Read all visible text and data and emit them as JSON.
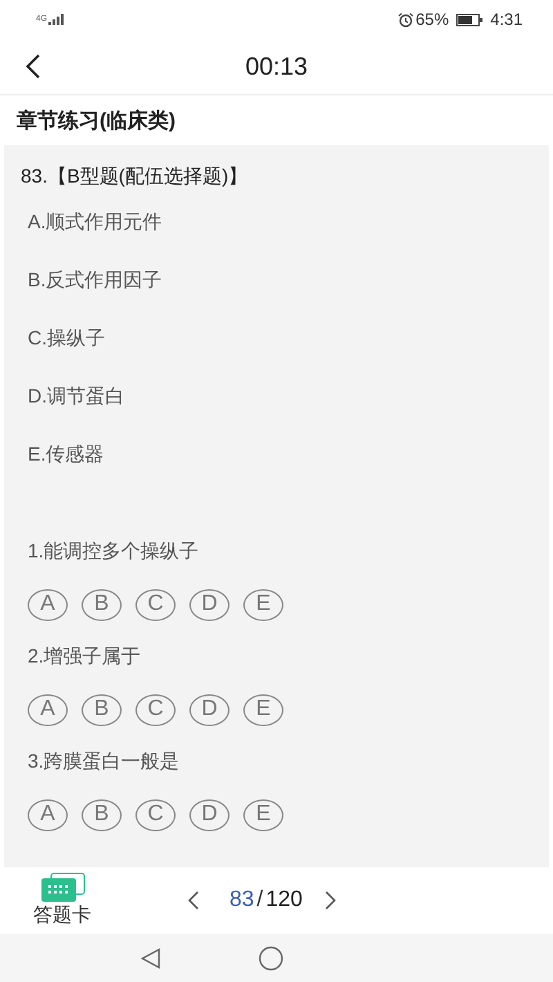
{
  "status_bar": {
    "network": "4G",
    "battery": "65%",
    "time": "4:31"
  },
  "header": {
    "timer": "00:13"
  },
  "section_title": "章节练习(临床类)",
  "question": {
    "title": "83.【B型题(配伍选择题)】",
    "options": [
      "A.顺式作用元件",
      "B.反式作用因子",
      "C.操纵子",
      "D.调节蛋白",
      "E.传感器"
    ]
  },
  "sub_questions": [
    {
      "text": "1.能调控多个操纵子",
      "choices": [
        {
          "label": "A",
          "selected": false
        },
        {
          "label": "B",
          "selected": false
        },
        {
          "label": "C",
          "selected": false
        },
        {
          "label": "D",
          "selected": false
        },
        {
          "label": "E",
          "selected": false
        }
      ]
    },
    {
      "text": "2.增强子属于",
      "choices": [
        {
          "label": "A",
          "selected": false
        },
        {
          "label": "B",
          "selected": false
        },
        {
          "label": "C",
          "selected": false
        },
        {
          "label": "D",
          "selected": false
        },
        {
          "label": "E",
          "selected": false
        }
      ]
    },
    {
      "text": "3.跨膜蛋白一般是",
      "choices": [
        {
          "label": "A",
          "selected": false
        },
        {
          "label": "B",
          "selected": false
        },
        {
          "label": "C",
          "selected": false
        },
        {
          "label": "D",
          "selected": false
        },
        {
          "label": "E",
          "selected": false
        }
      ]
    }
  ],
  "bottom_bar": {
    "answer_card": "答题卡",
    "current": "83",
    "separator": "/",
    "total": "120"
  }
}
